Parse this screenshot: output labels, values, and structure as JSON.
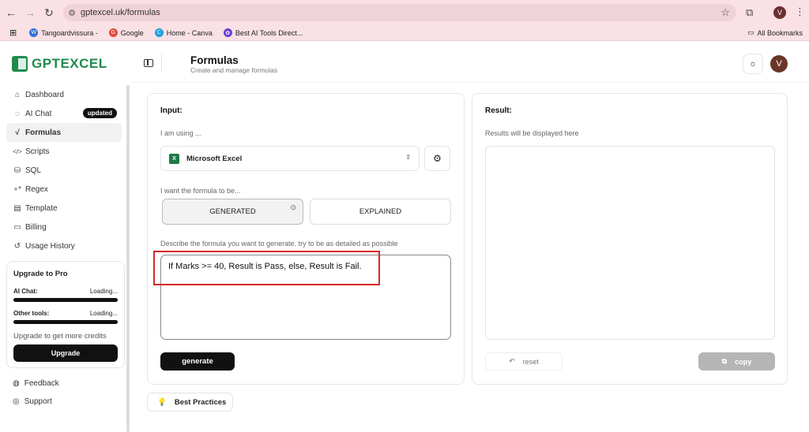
{
  "browser": {
    "url": "gptexcel.uk/formulas",
    "profile_initial": "V",
    "bookmarks": [
      {
        "label": "Tangoardvissura -",
        "color": "#2f6fd6",
        "glyph": "W"
      },
      {
        "label": "Google",
        "color": "#e04a3b",
        "glyph": "G"
      },
      {
        "label": "Home - Canva",
        "color": "#1ea0d8",
        "glyph": "C"
      },
      {
        "label": "Best AI Tools Direct...",
        "color": "#6a3fd6",
        "glyph": "✿"
      }
    ],
    "all_bookmarks": "All Bookmarks"
  },
  "logo": {
    "text": "GPTEXCEL"
  },
  "sidebar": {
    "items": [
      {
        "label": "Dashboard",
        "icon": "⌂"
      },
      {
        "label": "AI Chat",
        "icon": "◌",
        "badge": "updated"
      },
      {
        "label": "Formulas",
        "icon": "√",
        "active": true
      },
      {
        "label": "Scripts",
        "icon": "</>"
      },
      {
        "label": "SQL",
        "icon": "⛁"
      },
      {
        "label": "Regex",
        "icon": "∘*"
      },
      {
        "label": "Template",
        "icon": "▤"
      },
      {
        "label": "Billing",
        "icon": "▭"
      },
      {
        "label": "Usage History",
        "icon": "↺"
      }
    ],
    "upgrade": {
      "title": "Upgrade to Pro",
      "ai_chat_label": "AI Chat:",
      "ai_chat_value": "Loading...",
      "other_label": "Other tools:",
      "other_value": "Loading...",
      "more_text": "Upgrade to get more credits",
      "button": "Upgrade"
    },
    "feedback": "Feedback",
    "support": "Support"
  },
  "header": {
    "title": "Formulas",
    "subtitle": "Create and manage formulas",
    "avatar": "V"
  },
  "input": {
    "title": "Input:",
    "using_label": "I am using ...",
    "app": "Microsoft Excel",
    "formula_label": "I want the formula to be...",
    "option_generated": "GENERATED",
    "option_explained": "EXPLAINED",
    "describe_label": "Describe the formula you want to generate. try to be as detailed as possible",
    "prompt_value": "If Marks >= 40, Result is Pass, else, Result is Fail.",
    "generate_button": "generate"
  },
  "result": {
    "title": "Result:",
    "placeholder": "Results will be displayed here",
    "reset_button": "reset",
    "copy_button": "copy"
  },
  "best_practices": "Best Practices"
}
